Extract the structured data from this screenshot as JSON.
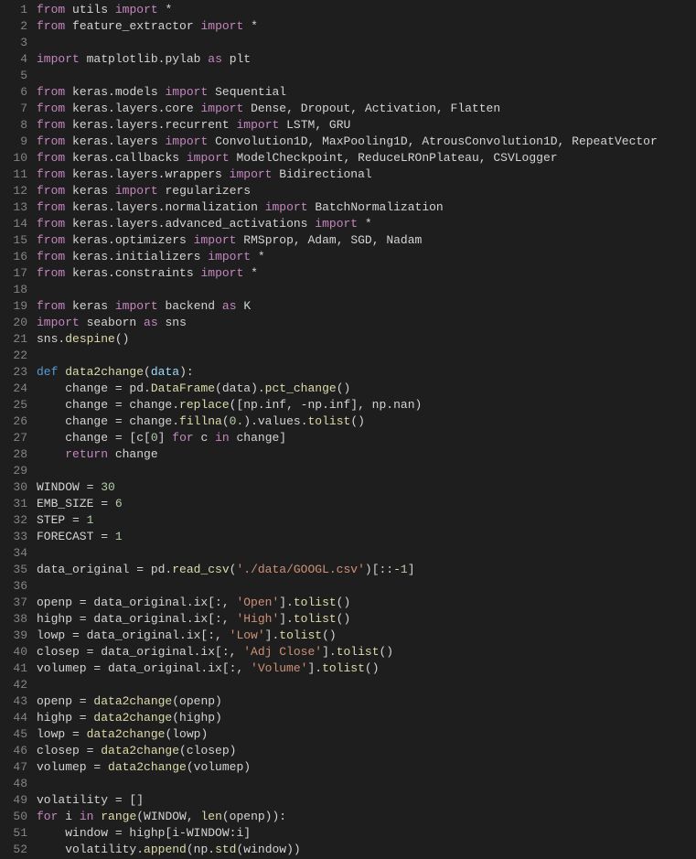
{
  "lines": [
    {
      "n": "1",
      "tokens": [
        [
          "kw",
          "from"
        ],
        [
          "sp",
          " "
        ],
        [
          "mod2",
          "utils"
        ],
        [
          "sp",
          " "
        ],
        [
          "kw",
          "import"
        ],
        [
          "sp",
          " "
        ],
        [
          "op",
          "*"
        ]
      ]
    },
    {
      "n": "2",
      "tokens": [
        [
          "kw",
          "from"
        ],
        [
          "sp",
          " "
        ],
        [
          "mod2",
          "feature_extractor"
        ],
        [
          "sp",
          " "
        ],
        [
          "kw",
          "import"
        ],
        [
          "sp",
          " "
        ],
        [
          "op",
          "*"
        ]
      ]
    },
    {
      "n": "3",
      "tokens": []
    },
    {
      "n": "4",
      "tokens": [
        [
          "kw",
          "import"
        ],
        [
          "sp",
          " "
        ],
        [
          "mod2",
          "matplotlib.pylab"
        ],
        [
          "sp",
          " "
        ],
        [
          "kw",
          "as"
        ],
        [
          "sp",
          " "
        ],
        [
          "mod2",
          "plt"
        ]
      ]
    },
    {
      "n": "5",
      "tokens": []
    },
    {
      "n": "6",
      "tokens": [
        [
          "kw",
          "from"
        ],
        [
          "sp",
          " "
        ],
        [
          "mod2",
          "keras.models"
        ],
        [
          "sp",
          " "
        ],
        [
          "kw",
          "import"
        ],
        [
          "sp",
          " "
        ],
        [
          "mod2",
          "Sequential"
        ]
      ]
    },
    {
      "n": "7",
      "tokens": [
        [
          "kw",
          "from"
        ],
        [
          "sp",
          " "
        ],
        [
          "mod2",
          "keras.layers.core"
        ],
        [
          "sp",
          " "
        ],
        [
          "kw",
          "import"
        ],
        [
          "sp",
          " "
        ],
        [
          "mod2",
          "Dense, Dropout, Activation, Flatten"
        ]
      ]
    },
    {
      "n": "8",
      "tokens": [
        [
          "kw",
          "from"
        ],
        [
          "sp",
          " "
        ],
        [
          "mod2",
          "keras.layers.recurrent"
        ],
        [
          "sp",
          " "
        ],
        [
          "kw",
          "import"
        ],
        [
          "sp",
          " "
        ],
        [
          "mod2",
          "LSTM, GRU"
        ]
      ]
    },
    {
      "n": "9",
      "tokens": [
        [
          "kw",
          "from"
        ],
        [
          "sp",
          " "
        ],
        [
          "mod2",
          "keras.layers"
        ],
        [
          "sp",
          " "
        ],
        [
          "kw",
          "import"
        ],
        [
          "sp",
          " "
        ],
        [
          "mod2",
          "Convolution1D, MaxPooling1D, AtrousConvolution1D, RepeatVector"
        ]
      ]
    },
    {
      "n": "10",
      "tokens": [
        [
          "kw",
          "from"
        ],
        [
          "sp",
          " "
        ],
        [
          "mod2",
          "keras.callbacks"
        ],
        [
          "sp",
          " "
        ],
        [
          "kw",
          "import"
        ],
        [
          "sp",
          " "
        ],
        [
          "mod2",
          "ModelCheckpoint, ReduceLROnPlateau, CSVLogger"
        ]
      ]
    },
    {
      "n": "11",
      "tokens": [
        [
          "kw",
          "from"
        ],
        [
          "sp",
          " "
        ],
        [
          "mod2",
          "keras.layers.wrappers"
        ],
        [
          "sp",
          " "
        ],
        [
          "kw",
          "import"
        ],
        [
          "sp",
          " "
        ],
        [
          "mod2",
          "Bidirectional"
        ]
      ]
    },
    {
      "n": "12",
      "tokens": [
        [
          "kw",
          "from"
        ],
        [
          "sp",
          " "
        ],
        [
          "mod2",
          "keras"
        ],
        [
          "sp",
          " "
        ],
        [
          "kw",
          "import"
        ],
        [
          "sp",
          " "
        ],
        [
          "mod2",
          "regularizers"
        ]
      ]
    },
    {
      "n": "13",
      "tokens": [
        [
          "kw",
          "from"
        ],
        [
          "sp",
          " "
        ],
        [
          "mod2",
          "keras.layers.normalization"
        ],
        [
          "sp",
          " "
        ],
        [
          "kw",
          "import"
        ],
        [
          "sp",
          " "
        ],
        [
          "mod2",
          "BatchNormalization"
        ]
      ]
    },
    {
      "n": "14",
      "tokens": [
        [
          "kw",
          "from"
        ],
        [
          "sp",
          " "
        ],
        [
          "mod2",
          "keras.layers.advanced_activations"
        ],
        [
          "sp",
          " "
        ],
        [
          "kw",
          "import"
        ],
        [
          "sp",
          " "
        ],
        [
          "op",
          "*"
        ]
      ]
    },
    {
      "n": "15",
      "tokens": [
        [
          "kw",
          "from"
        ],
        [
          "sp",
          " "
        ],
        [
          "mod2",
          "keras.optimizers"
        ],
        [
          "sp",
          " "
        ],
        [
          "kw",
          "import"
        ],
        [
          "sp",
          " "
        ],
        [
          "mod2",
          "RMSprop, Adam, SGD, Nadam"
        ]
      ]
    },
    {
      "n": "16",
      "tokens": [
        [
          "kw",
          "from"
        ],
        [
          "sp",
          " "
        ],
        [
          "mod2",
          "keras.initializers"
        ],
        [
          "sp",
          " "
        ],
        [
          "kw",
          "import"
        ],
        [
          "sp",
          " "
        ],
        [
          "op",
          "*"
        ]
      ]
    },
    {
      "n": "17",
      "tokens": [
        [
          "kw",
          "from"
        ],
        [
          "sp",
          " "
        ],
        [
          "mod2",
          "keras.constraints"
        ],
        [
          "sp",
          " "
        ],
        [
          "kw",
          "import"
        ],
        [
          "sp",
          " "
        ],
        [
          "op",
          "*"
        ]
      ]
    },
    {
      "n": "18",
      "tokens": []
    },
    {
      "n": "19",
      "tokens": [
        [
          "kw",
          "from"
        ],
        [
          "sp",
          " "
        ],
        [
          "mod2",
          "keras"
        ],
        [
          "sp",
          " "
        ],
        [
          "kw",
          "import"
        ],
        [
          "sp",
          " "
        ],
        [
          "mod2",
          "backend"
        ],
        [
          "sp",
          " "
        ],
        [
          "kw",
          "as"
        ],
        [
          "sp",
          " "
        ],
        [
          "mod2",
          "K"
        ]
      ]
    },
    {
      "n": "20",
      "tokens": [
        [
          "kw",
          "import"
        ],
        [
          "sp",
          " "
        ],
        [
          "mod2",
          "seaborn"
        ],
        [
          "sp",
          " "
        ],
        [
          "kw",
          "as"
        ],
        [
          "sp",
          " "
        ],
        [
          "mod2",
          "sns"
        ]
      ]
    },
    {
      "n": "21",
      "tokens": [
        [
          "mod2",
          "sns."
        ],
        [
          "fn",
          "despine"
        ],
        [
          "mod2",
          "()"
        ]
      ]
    },
    {
      "n": "22",
      "tokens": []
    },
    {
      "n": "23",
      "tokens": [
        [
          "const",
          "def"
        ],
        [
          "sp",
          " "
        ],
        [
          "defname",
          "data2change"
        ],
        [
          "mod2",
          "("
        ],
        [
          "param",
          "data"
        ],
        [
          "mod2",
          "):"
        ]
      ]
    },
    {
      "n": "24",
      "tokens": [
        [
          "sp",
          "    "
        ],
        [
          "mod2",
          "change = pd."
        ],
        [
          "fn",
          "DataFrame"
        ],
        [
          "mod2",
          "(data)."
        ],
        [
          "fn",
          "pct_change"
        ],
        [
          "mod2",
          "()"
        ]
      ]
    },
    {
      "n": "25",
      "tokens": [
        [
          "sp",
          "    "
        ],
        [
          "mod2",
          "change = change."
        ],
        [
          "fn",
          "replace"
        ],
        [
          "mod2",
          "([np.inf, -np.inf], np.nan)"
        ]
      ]
    },
    {
      "n": "26",
      "tokens": [
        [
          "sp",
          "    "
        ],
        [
          "mod2",
          "change = change."
        ],
        [
          "fn",
          "fillna"
        ],
        [
          "mod2",
          "("
        ],
        [
          "num",
          "0."
        ],
        [
          "mod2",
          ").values."
        ],
        [
          "fn",
          "tolist"
        ],
        [
          "mod2",
          "()"
        ]
      ]
    },
    {
      "n": "27",
      "tokens": [
        [
          "sp",
          "    "
        ],
        [
          "mod2",
          "change = [c["
        ],
        [
          "num",
          "0"
        ],
        [
          "mod2",
          "] "
        ],
        [
          "kw",
          "for"
        ],
        [
          "mod2",
          " c "
        ],
        [
          "kw",
          "in"
        ],
        [
          "mod2",
          " change]"
        ]
      ]
    },
    {
      "n": "28",
      "tokens": [
        [
          "sp",
          "    "
        ],
        [
          "kw",
          "return"
        ],
        [
          "mod2",
          " change"
        ]
      ]
    },
    {
      "n": "29",
      "tokens": []
    },
    {
      "n": "30",
      "tokens": [
        [
          "mod2",
          "WINDOW = "
        ],
        [
          "num",
          "30"
        ]
      ]
    },
    {
      "n": "31",
      "tokens": [
        [
          "mod2",
          "EMB_SIZE = "
        ],
        [
          "num",
          "6"
        ]
      ]
    },
    {
      "n": "32",
      "tokens": [
        [
          "mod2",
          "STEP = "
        ],
        [
          "num",
          "1"
        ]
      ]
    },
    {
      "n": "33",
      "tokens": [
        [
          "mod2",
          "FORECAST = "
        ],
        [
          "num",
          "1"
        ]
      ]
    },
    {
      "n": "34",
      "tokens": []
    },
    {
      "n": "35",
      "tokens": [
        [
          "mod2",
          "data_original = pd."
        ],
        [
          "fn",
          "read_csv"
        ],
        [
          "mod2",
          "("
        ],
        [
          "str",
          "'./data/GOOGL.csv'"
        ],
        [
          "mod2",
          ")[::-"
        ],
        [
          "num",
          "1"
        ],
        [
          "mod2",
          "]"
        ]
      ]
    },
    {
      "n": "36",
      "tokens": []
    },
    {
      "n": "37",
      "tokens": [
        [
          "mod2",
          "openp = data_original.ix[:, "
        ],
        [
          "str",
          "'Open'"
        ],
        [
          "mod2",
          "]."
        ],
        [
          "fn",
          "tolist"
        ],
        [
          "mod2",
          "()"
        ]
      ]
    },
    {
      "n": "38",
      "tokens": [
        [
          "mod2",
          "highp = data_original.ix[:, "
        ],
        [
          "str",
          "'High'"
        ],
        [
          "mod2",
          "]."
        ],
        [
          "fn",
          "tolist"
        ],
        [
          "mod2",
          "()"
        ]
      ]
    },
    {
      "n": "39",
      "tokens": [
        [
          "mod2",
          "lowp = data_original.ix[:, "
        ],
        [
          "str",
          "'Low'"
        ],
        [
          "mod2",
          "]."
        ],
        [
          "fn",
          "tolist"
        ],
        [
          "mod2",
          "()"
        ]
      ]
    },
    {
      "n": "40",
      "tokens": [
        [
          "mod2",
          "closep = data_original.ix[:, "
        ],
        [
          "str",
          "'Adj Close'"
        ],
        [
          "mod2",
          "]."
        ],
        [
          "fn",
          "tolist"
        ],
        [
          "mod2",
          "()"
        ]
      ]
    },
    {
      "n": "41",
      "tokens": [
        [
          "mod2",
          "volumep = data_original.ix[:, "
        ],
        [
          "str",
          "'Volume'"
        ],
        [
          "mod2",
          "]."
        ],
        [
          "fn",
          "tolist"
        ],
        [
          "mod2",
          "()"
        ]
      ]
    },
    {
      "n": "42",
      "tokens": []
    },
    {
      "n": "43",
      "tokens": [
        [
          "mod2",
          "openp = "
        ],
        [
          "fn",
          "data2change"
        ],
        [
          "mod2",
          "(openp)"
        ]
      ]
    },
    {
      "n": "44",
      "tokens": [
        [
          "mod2",
          "highp = "
        ],
        [
          "fn",
          "data2change"
        ],
        [
          "mod2",
          "(highp)"
        ]
      ]
    },
    {
      "n": "45",
      "tokens": [
        [
          "mod2",
          "lowp = "
        ],
        [
          "fn",
          "data2change"
        ],
        [
          "mod2",
          "(lowp)"
        ]
      ]
    },
    {
      "n": "46",
      "tokens": [
        [
          "mod2",
          "closep = "
        ],
        [
          "fn",
          "data2change"
        ],
        [
          "mod2",
          "(closep)"
        ]
      ]
    },
    {
      "n": "47",
      "tokens": [
        [
          "mod2",
          "volumep = "
        ],
        [
          "fn",
          "data2change"
        ],
        [
          "mod2",
          "(volumep)"
        ]
      ]
    },
    {
      "n": "48",
      "tokens": []
    },
    {
      "n": "49",
      "tokens": [
        [
          "mod2",
          "volatility = []"
        ]
      ]
    },
    {
      "n": "50",
      "tokens": [
        [
          "kw",
          "for"
        ],
        [
          "mod2",
          " i "
        ],
        [
          "kw",
          "in"
        ],
        [
          "sp",
          " "
        ],
        [
          "fn",
          "range"
        ],
        [
          "mod2",
          "(WINDOW, "
        ],
        [
          "fn",
          "len"
        ],
        [
          "mod2",
          "(openp)):"
        ]
      ]
    },
    {
      "n": "51",
      "tokens": [
        [
          "sp",
          "    "
        ],
        [
          "mod2",
          "window = highp[i-WINDOW:i]"
        ]
      ]
    },
    {
      "n": "52",
      "tokens": [
        [
          "sp",
          "    "
        ],
        [
          "mod2",
          "volatility."
        ],
        [
          "fn",
          "append"
        ],
        [
          "mod2",
          "(np."
        ],
        [
          "fn",
          "std"
        ],
        [
          "mod2",
          "(window))"
        ]
      ]
    }
  ]
}
